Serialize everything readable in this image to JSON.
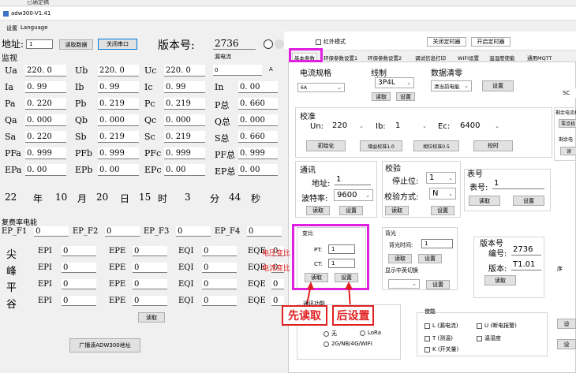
{
  "os_topbar": "已确定稿",
  "window": {
    "title": "adw300-V1.41"
  },
  "menu": [
    "设置",
    "Language"
  ],
  "conn": {
    "addr_label": "地址:",
    "addr_value": "1",
    "read_btn": "读取数据",
    "close_port_btn": "关闭串口",
    "version_label": "版本号:",
    "version_value": "2736"
  },
  "monitor": {
    "title": "监视",
    "leak_title": "漏电流",
    "leak_value": "0",
    "leak_unit": "A",
    "rows": [
      [
        [
          "Ua",
          "220. 0"
        ],
        [
          "Ub",
          "220. 0"
        ],
        [
          "Uc",
          "220. 0"
        ]
      ],
      [
        [
          "Ia",
          "0. 99"
        ],
        [
          "Ib",
          "0. 99"
        ],
        [
          "Ic",
          "0. 99"
        ],
        [
          "In",
          "0. 00"
        ]
      ],
      [
        [
          "Pa",
          "0. 220"
        ],
        [
          "Pb",
          "0. 219"
        ],
        [
          "Pc",
          "0. 219"
        ],
        [
          "P总",
          "0. 660"
        ]
      ],
      [
        [
          "Qa",
          "0. 000"
        ],
        [
          "Qb",
          "0. 000"
        ],
        [
          "Qc",
          "0. 000"
        ],
        [
          "Q总",
          "0. 000"
        ]
      ],
      [
        [
          "Sa",
          "0. 220"
        ],
        [
          "Sb",
          "0. 219"
        ],
        [
          "Sc",
          "0. 219"
        ],
        [
          "S总",
          "0. 660"
        ]
      ],
      [
        [
          "PFa",
          "0. 999"
        ],
        [
          "PFb",
          "0. 999"
        ],
        [
          "PFc",
          "0. 999"
        ],
        [
          "PF总",
          "0. 999"
        ]
      ],
      [
        [
          "EPa",
          "0. 00"
        ],
        [
          "EPb",
          "0. 00"
        ],
        [
          "EPc",
          "0. 00"
        ],
        [
          "EP总",
          "0. 00"
        ]
      ]
    ],
    "date": {
      "yy": "22",
      "yl": "年",
      "mo": "10",
      "mol": "月",
      "d": "20",
      "dl": "日",
      "h": "15",
      "hl": "时",
      "mi": "3",
      "mil": "分",
      "s": "44",
      "sl": "秒"
    }
  },
  "billing": {
    "title": "复费率电能",
    "ep": [
      [
        "EP_F1",
        "0"
      ],
      [
        "EP_F2",
        "0"
      ],
      [
        "EP_F3",
        "0"
      ],
      [
        "EP_F4",
        "0"
      ]
    ],
    "rows": [
      {
        "name": "尖",
        "v": [
          [
            "EPI",
            "0"
          ],
          [
            "EPE",
            "0"
          ],
          [
            "EQI",
            "0"
          ],
          [
            "EQE",
            "0"
          ]
        ]
      },
      {
        "name": "峰",
        "v": [
          [
            "EPI",
            "0"
          ],
          [
            "EPE",
            "0"
          ],
          [
            "EQI",
            "0"
          ],
          [
            "EQE",
            "0"
          ]
        ]
      },
      {
        "name": "平",
        "v": [
          [
            "EPI",
            "0"
          ],
          [
            "EPE",
            "0"
          ],
          [
            "EQI",
            "0"
          ],
          [
            "EQE",
            "0"
          ]
        ]
      },
      {
        "name": "谷",
        "v": [
          [
            "EPI",
            "0"
          ],
          [
            "EPE",
            "0"
          ],
          [
            "EQI",
            "0"
          ],
          [
            "EQE",
            "0"
          ]
        ]
      }
    ],
    "read_btn": "读取",
    "broadcast_btn": "广播读ADW300地址"
  },
  "right_top": {
    "infrared": "红外模式",
    "close_timer": "关闭定时器",
    "open_timer": "开启定时器"
  },
  "tabs": [
    "基本参数",
    "环保参数设置1",
    "环保参数设置2",
    "调试信息打印",
    "WIFI设置",
    "温湿度使能",
    "通用MQTT"
  ],
  "current_spec": {
    "title": "电流规格",
    "value": "6A"
  },
  "wiring": {
    "title": "线制",
    "value": "3P4L",
    "read": "读取",
    "set": "设置"
  },
  "data_clear": {
    "title": "数据清零",
    "value": "清当前电能",
    "set": "设置"
  },
  "sc": "SC",
  "residual": {
    "title": "剩余电流校",
    "zero_btn": "零点校",
    "rc_title": "剩余电",
    "read": "读"
  },
  "calib": {
    "title": "校准",
    "un_label": "Un:",
    "un_value": "220",
    "ib_label": "Ib:",
    "ib_value": "1",
    "ec_label": "Ec:",
    "ec_value": "6400",
    "init_btn": "初始化",
    "gain_btn": "增益校准1.0",
    "phase_btn": "相位校准0.5",
    "cal_btn": "校时"
  },
  "comm": {
    "title": "通讯",
    "addr_label": "地址:",
    "addr_value": "1",
    "baud_label": "波特率:",
    "baud_value": "9600",
    "read": "读取",
    "set": "设置"
  },
  "check": {
    "title": "校验",
    "stop_label": "停止位:",
    "stop_value": "1",
    "mode_label": "校验方式:",
    "mode_value": "N",
    "read": "读取",
    "set": "设置"
  },
  "meter": {
    "title": "表号",
    "label": "表号:",
    "value": "1",
    "read": "读取",
    "set": "设置"
  },
  "ratio": {
    "title": "变比",
    "pt_label": "PT:",
    "pt_value": "1",
    "ct_label": "CT:",
    "ct_value": "1",
    "read": "读取",
    "set": "设置",
    "ann_pt": "电压变比",
    "ann_ct": "电流变比"
  },
  "backlight": {
    "title": "背光",
    "time_label": "背光时间:",
    "time_value": "1",
    "read": "读取",
    "set": "设置",
    "display_title": "显示中英切换",
    "display_set": "设置"
  },
  "version": {
    "title": "版本号",
    "code_label": "编号:",
    "code_value": "2736",
    "ver_label": "版本:",
    "ver_value": "T1.01",
    "read": "读取",
    "side": "序"
  },
  "comm_func": {
    "title": "通讯功能",
    "opt_none": "无",
    "opt_lora": "LoRa",
    "opt_2g": "2G/NB/4G/WIFI"
  },
  "enable": {
    "title": "使能",
    "l": "L (漏电流)",
    "u": "U (断电报警)",
    "t": "T (测温)",
    "th": "温湿度",
    "k": "K (开关量)",
    "side1": "设",
    "side2": "设"
  },
  "annotations": {
    "first_read": "先读取",
    "then_set": "后设置"
  },
  "colors": {
    "highlight": "#e020e0",
    "annotation": "#e02020"
  }
}
